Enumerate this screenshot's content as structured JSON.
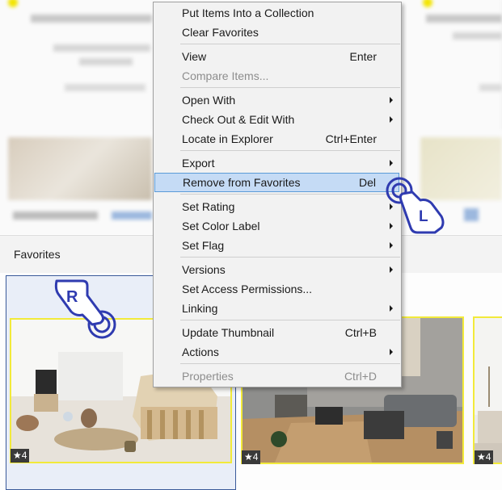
{
  "favorites_panel": {
    "title": "Favorites",
    "cards": [
      {
        "rating": "★4"
      },
      {
        "rating": "★4"
      },
      {
        "rating": "★4"
      }
    ]
  },
  "context_menu": {
    "items": [
      {
        "label": "Put Items Into a Collection",
        "shortcut": "",
        "submenu": false,
        "disabled": false
      },
      {
        "label": "Clear Favorites",
        "shortcut": "",
        "submenu": false,
        "disabled": false
      },
      {
        "label": "View",
        "shortcut": "Enter",
        "submenu": false,
        "disabled": false
      },
      {
        "label": "Compare Items...",
        "shortcut": "",
        "submenu": false,
        "disabled": true
      },
      {
        "label": "Open With",
        "shortcut": "",
        "submenu": true,
        "disabled": false
      },
      {
        "label": "Check Out & Edit With",
        "shortcut": "",
        "submenu": true,
        "disabled": false
      },
      {
        "label": "Locate in Explorer",
        "shortcut": "Ctrl+Enter",
        "submenu": false,
        "disabled": false
      },
      {
        "label": "Export",
        "shortcut": "",
        "submenu": true,
        "disabled": false
      },
      {
        "label": "Remove from Favorites",
        "shortcut": "Del",
        "submenu": false,
        "disabled": false,
        "highlighted": true
      },
      {
        "label": "Set Rating",
        "shortcut": "",
        "submenu": true,
        "disabled": false
      },
      {
        "label": "Set Color Label",
        "shortcut": "",
        "submenu": true,
        "disabled": false
      },
      {
        "label": "Set Flag",
        "shortcut": "",
        "submenu": true,
        "disabled": false
      },
      {
        "label": "Versions",
        "shortcut": "",
        "submenu": true,
        "disabled": false
      },
      {
        "label": "Set Access Permissions...",
        "shortcut": "",
        "submenu": false,
        "disabled": false
      },
      {
        "label": "Linking",
        "shortcut": "",
        "submenu": true,
        "disabled": false
      },
      {
        "label": "Update Thumbnail",
        "shortcut": "Ctrl+B",
        "submenu": false,
        "disabled": false
      },
      {
        "label": "Actions",
        "shortcut": "",
        "submenu": true,
        "disabled": false
      },
      {
        "label": "Properties",
        "shortcut": "Ctrl+D",
        "submenu": false,
        "disabled": true
      }
    ]
  },
  "annotations": {
    "right_click_marker": "R",
    "left_click_marker": "L",
    "accent_color": "#2f3bb0",
    "highlight_color": "#c5dbf5",
    "favorite_border_color": "#f2ea3a"
  }
}
